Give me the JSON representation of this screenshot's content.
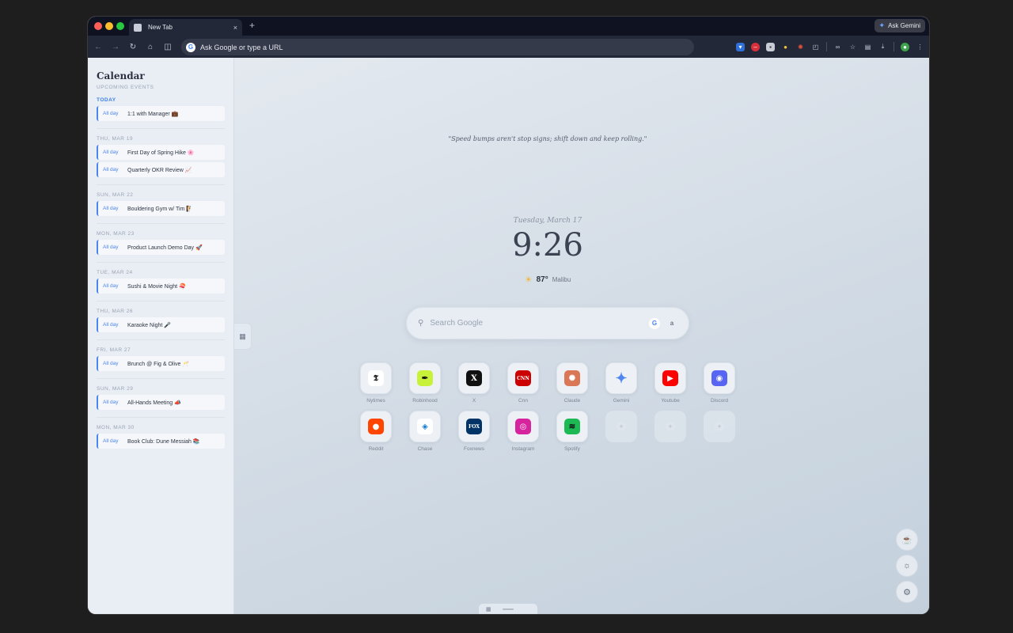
{
  "browser": {
    "tab_title": "New Tab",
    "new_tab": "+",
    "close": "×",
    "ask_gemini": "Ask Gemini",
    "address_placeholder": "Ask Google or type a URL"
  },
  "calendar": {
    "title": "Calendar",
    "subtitle": "UPCOMING EVENTS",
    "days": [
      {
        "label": "TODAY",
        "events": [
          {
            "time": "All day",
            "title": "1:1 with Manager 💼"
          }
        ]
      },
      {
        "label": "THU, MAR 19",
        "events": [
          {
            "time": "All day",
            "title": "First Day of Spring Hike 🌸"
          },
          {
            "time": "All day",
            "title": "Quarterly OKR Review 📈"
          }
        ]
      },
      {
        "label": "SUN, MAR 22",
        "events": [
          {
            "time": "All day",
            "title": "Bouldering Gym w/ Tim 🧗"
          }
        ]
      },
      {
        "label": "MON, MAR 23",
        "events": [
          {
            "time": "All day",
            "title": "Product Launch Demo Day 🚀"
          }
        ]
      },
      {
        "label": "TUE, MAR 24",
        "events": [
          {
            "time": "All day",
            "title": "Sushi & Movie Night 🍣"
          }
        ]
      },
      {
        "label": "THU, MAR 26",
        "events": [
          {
            "time": "All day",
            "title": "Karaoke Night 🎤"
          }
        ]
      },
      {
        "label": "FRI, MAR 27",
        "events": [
          {
            "time": "All day",
            "title": "Brunch @ Fig & Olive 🥂"
          }
        ]
      },
      {
        "label": "SUN, MAR 29",
        "events": [
          {
            "time": "All day",
            "title": "All-Hands Meeting 📣"
          }
        ]
      },
      {
        "label": "MON, MAR 30",
        "events": [
          {
            "time": "All day",
            "title": "Book Club: Dune Messiah 📚"
          }
        ]
      }
    ]
  },
  "newtab": {
    "quote": "\"Speed bumps aren't stop signs; shift down and keep rolling.\"",
    "date": "Tuesday, March 17",
    "time": "9:26",
    "temperature": "87°",
    "location": "Malibu",
    "search_placeholder": "Search Google"
  },
  "shortcuts": [
    {
      "label": "Nytimes",
      "glyph": "𝕿",
      "bg": "#ffffff",
      "fg": "#111111"
    },
    {
      "label": "Robinhood",
      "glyph": "✒",
      "bg": "#c8f23a",
      "fg": "#111111"
    },
    {
      "label": "X",
      "glyph": "X",
      "bg": "#111111",
      "fg": "#ffffff"
    },
    {
      "label": "Cnn",
      "glyph": "CNN",
      "bg": "#cc0000",
      "fg": "#ffffff"
    },
    {
      "label": "Claude",
      "glyph": "✺",
      "bg": "#d97757",
      "fg": "#ffffff"
    },
    {
      "label": "Gemini",
      "glyph": "✦",
      "bg": "transparent",
      "fg": "#4f86f0"
    },
    {
      "label": "Youtube",
      "glyph": "▶",
      "bg": "#ff0000",
      "fg": "#ffffff"
    },
    {
      "label": "Discord",
      "glyph": "◉",
      "bg": "#5865f2",
      "fg": "#ffffff"
    },
    {
      "label": "Reddit",
      "glyph": "●",
      "bg": "#ff4500",
      "fg": "#ffffff"
    },
    {
      "label": "Chase",
      "glyph": "◈",
      "bg": "#ffffff",
      "fg": "#117acf"
    },
    {
      "label": "Foxnews",
      "glyph": "FOX",
      "bg": "#003366",
      "fg": "#ffffff"
    },
    {
      "label": "Instagram",
      "glyph": "◎",
      "bg": "#d6249f",
      "fg": "#ffffff"
    },
    {
      "label": "Spotify",
      "glyph": "≋",
      "bg": "#1db954",
      "fg": "#111111"
    },
    {
      "label": "",
      "glyph": "+",
      "empty": true
    },
    {
      "label": "",
      "glyph": "+",
      "empty": true
    },
    {
      "label": "",
      "glyph": "+",
      "empty": true
    }
  ],
  "icons": {
    "back": "←",
    "forward": "→",
    "reload": "↻",
    "home": "⌂",
    "split": "◫",
    "calendar": "▦",
    "search": "⚲",
    "coffee": "☕",
    "brightness": "☼",
    "settings": "⚙"
  }
}
